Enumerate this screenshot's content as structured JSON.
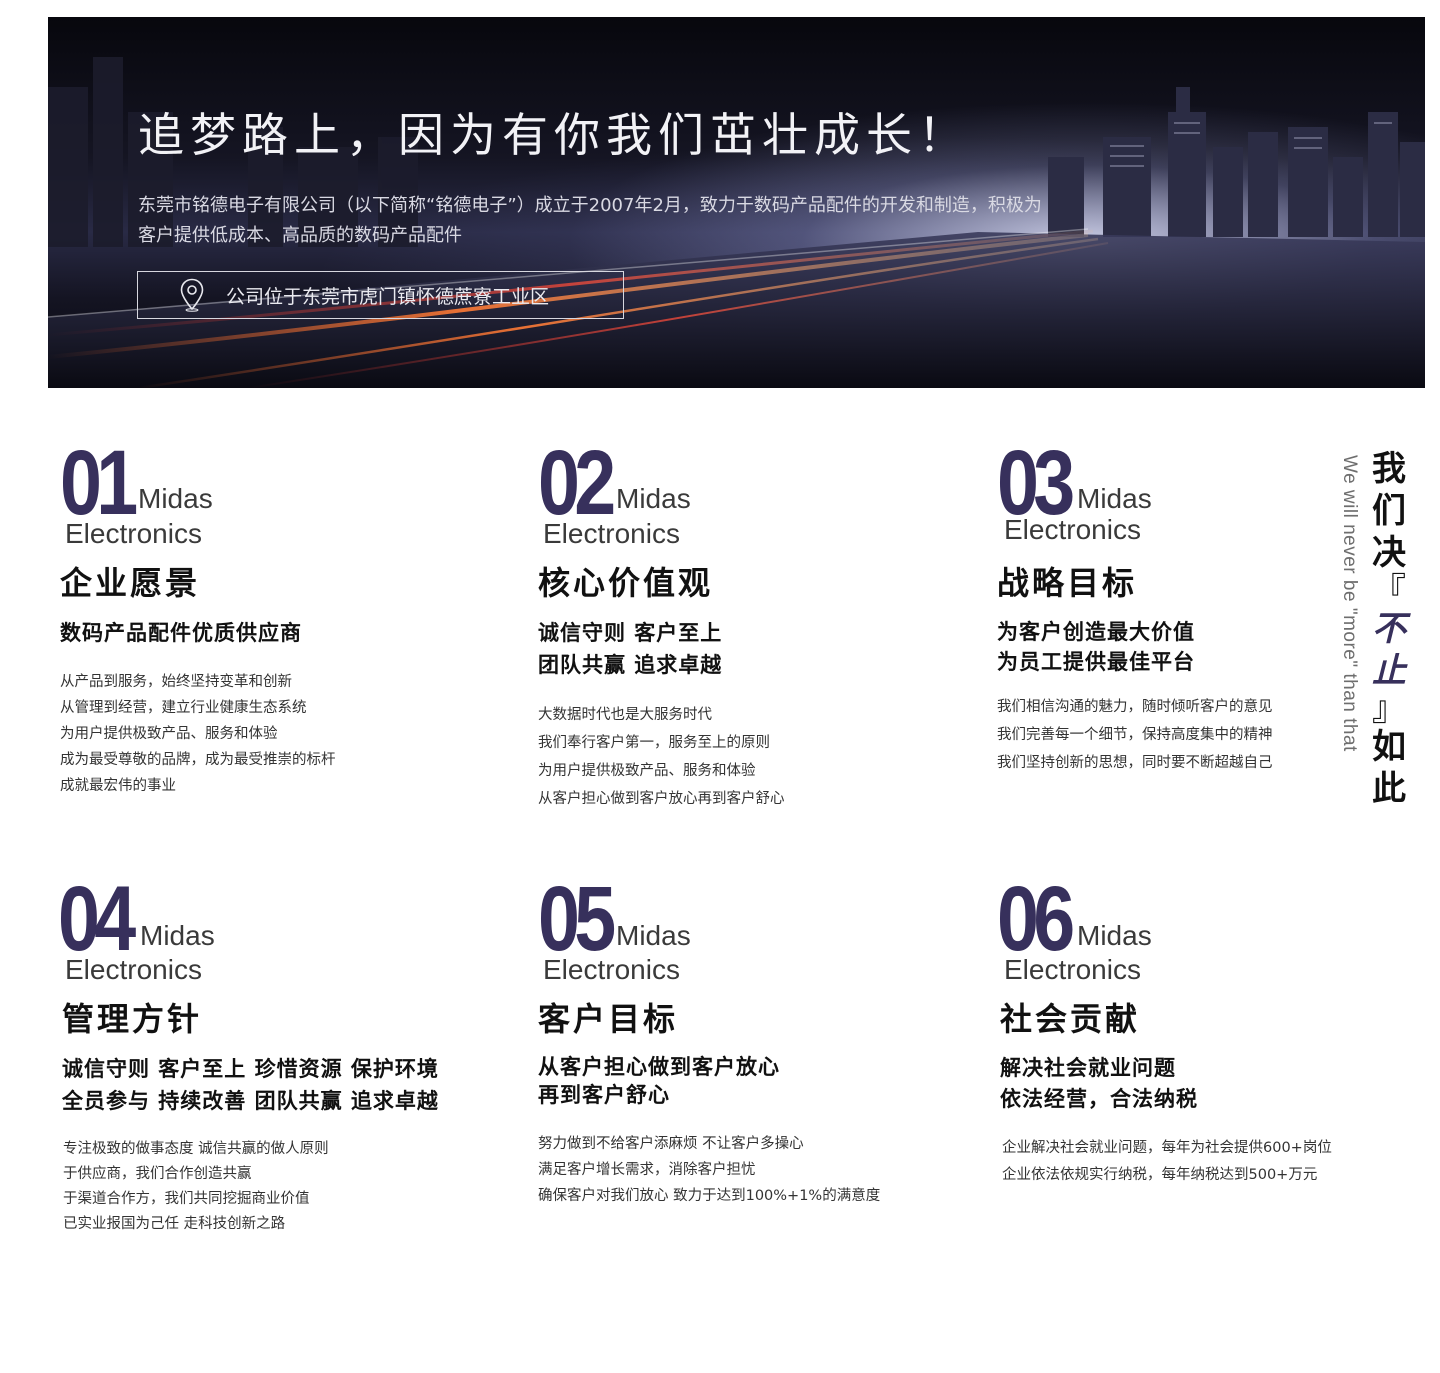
{
  "hero": {
    "title": "追梦路上，因为有你我们茁壮成长！",
    "description": "东莞市铭德电子有限公司（以下简称“铭德电子”）成立于2007年2月，致力于数码产品配件的开发和制造，积极为客户提供低成本、高品质的数码产品配件",
    "location": "公司位于东莞市虎门镇怀德蔗寮工业区",
    "location_icon": "location-pin-icon"
  },
  "cards": [
    {
      "number": "01",
      "brand_line1": "Midas",
      "brand_line2": "Electronics",
      "title": "企业愿景",
      "subtitle": [
        "数码产品配件优质供应商"
      ],
      "body": [
        "从产品到服务，始终坚持变革和创新",
        "从管理到经营，建立行业健康生态系统",
        "为用户提供极致产品、服务和体验",
        "成为最受尊敬的品牌，成为最受推崇的标杆",
        "成就最宏伟的事业"
      ]
    },
    {
      "number": "02",
      "brand_line1": "Midas",
      "brand_line2": "Electronics",
      "title": "核心价值观",
      "subtitle": [
        "诚信守则 客户至上",
        "团队共赢 追求卓越"
      ],
      "body": [
        "大数据时代也是大服务时代",
        "我们奉行客户第一，服务至上的原则",
        "为用户提供极致产品、服务和体验",
        "从客户担心做到客户放心再到客户舒心"
      ]
    },
    {
      "number": "03",
      "brand_line1": "Midas",
      "brand_line2": "Electronics",
      "title": "战略目标",
      "subtitle": [
        "为客户创造最大价值",
        "为员工提供最佳平台"
      ],
      "body": [
        "我们相信沟通的魅力，随时倾听客户的意见",
        "我们完善每一个细节，保持高度集中的精神",
        "我们坚持创新的思想，同时要不断超越自己"
      ]
    },
    {
      "number": "04",
      "brand_line1": "Midas",
      "brand_line2": "Electronics",
      "title": "管理方针",
      "subtitle": [
        "诚信守则 客户至上 珍惜资源 保护环境",
        "全员参与 持续改善 团队共赢 追求卓越"
      ],
      "body": [
        "专注极致的做事态度 诚信共赢的做人原则",
        "于供应商，我们合作创造共赢",
        "于渠道合作方，我们共同挖掘商业价值",
        "已实业报国为己任 走科技创新之路"
      ]
    },
    {
      "number": "05",
      "brand_line1": "Midas",
      "brand_line2": "Electronics",
      "title": "客户目标",
      "subtitle": [
        "从客户担心做到客户放心",
        "再到客户舒心"
      ],
      "body": [
        "努力做到不给客户添麻烦  不让客户多操心",
        "满足客户增长需求，消除客户担忧",
        "确保客户对我们放心  致力于达到100%+1%的满意度"
      ]
    },
    {
      "number": "06",
      "brand_line1": "Midas",
      "brand_line2": "Electronics",
      "title": "社会贡献",
      "subtitle": [
        "解决社会就业问题",
        "依法经营，合法纳税"
      ],
      "body": [
        "企业解决社会就业问题，每年为社会提供600+岗位",
        "企业依法依规实行纳税，每年纳税达到500+万元"
      ]
    }
  ],
  "slogan": {
    "english": "We will never be \"more\" than that",
    "cn_1": "我",
    "cn_2": "们",
    "cn_3": "决",
    "cn_open": "『",
    "cn_accent_1": "不",
    "cn_accent_2": "止",
    "cn_close": "』",
    "cn_4": "如",
    "cn_5": "此"
  },
  "colors": {
    "accent": "#37305c",
    "hero_dark": "#0b0b14",
    "text": "#111111"
  }
}
